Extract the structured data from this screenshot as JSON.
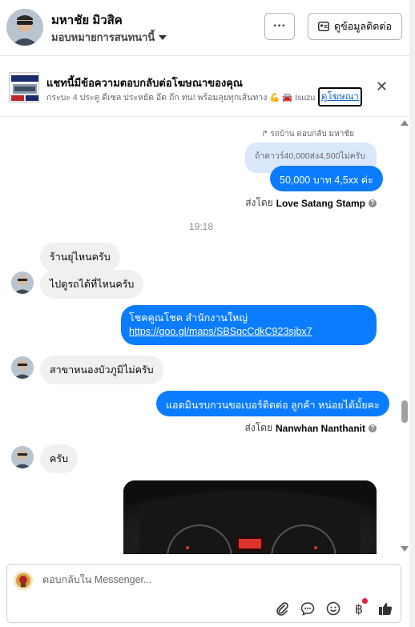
{
  "header": {
    "contact_name": "มหาชัย มิวสิค",
    "assign_label": "มอบหมายการสนทนานี้",
    "more_label": "···",
    "contact_info_label": "ดูข้อมูลติดต่อ"
  },
  "ad_banner": {
    "title": "แชทนี้มีข้อความตอบกลับต่อโฆษณาของคุณ",
    "subtitle": "กระบะ 4 ประตู ดีเซล ประหยัด อึด ถึก ทน! พร้อมลุยทุกเส้นทาง 💪 🚘 Isuzu",
    "view_ad_label": "ดูโฆษณา"
  },
  "messages": {
    "reply_note": "↱ รถบ้าน ตอบกลับ มหาชัย",
    "quoted_text": "ถ้าดาวร์40,000ส่ง4,500ไม่ครับ",
    "msg1": "50,000 บาท 4,5xx ค่ะ",
    "sent_by_prefix_1": "ส่งโดย",
    "sent_by_name_1": "Love Satang Stamp",
    "time_divider": "19:18",
    "in1": "ร้านยุ่ไหนครับ",
    "in2": "ไปดูรถได้ที่ไหนครับ",
    "out2_line1": "โชคคูณโชค สำนักงานใหญ่",
    "out2_link": "https://goo.gl/maps/SBSqcCdkC923sjbx7",
    "in3": "สาขาหนองบัวภูมิไม่ครับ",
    "out3": "แอดมินรบกวนขอเบอร์ติดต่อ ลูกค้า หน่อยได้มั้ยคะ",
    "sent_by_prefix_2": "ส่งโดย",
    "sent_by_name_2": "Nanwhan Nanthanit",
    "in4": "ครับ",
    "info_glyph": "?"
  },
  "composer": {
    "placeholder": "ตอบกลับใน Messenger..."
  }
}
